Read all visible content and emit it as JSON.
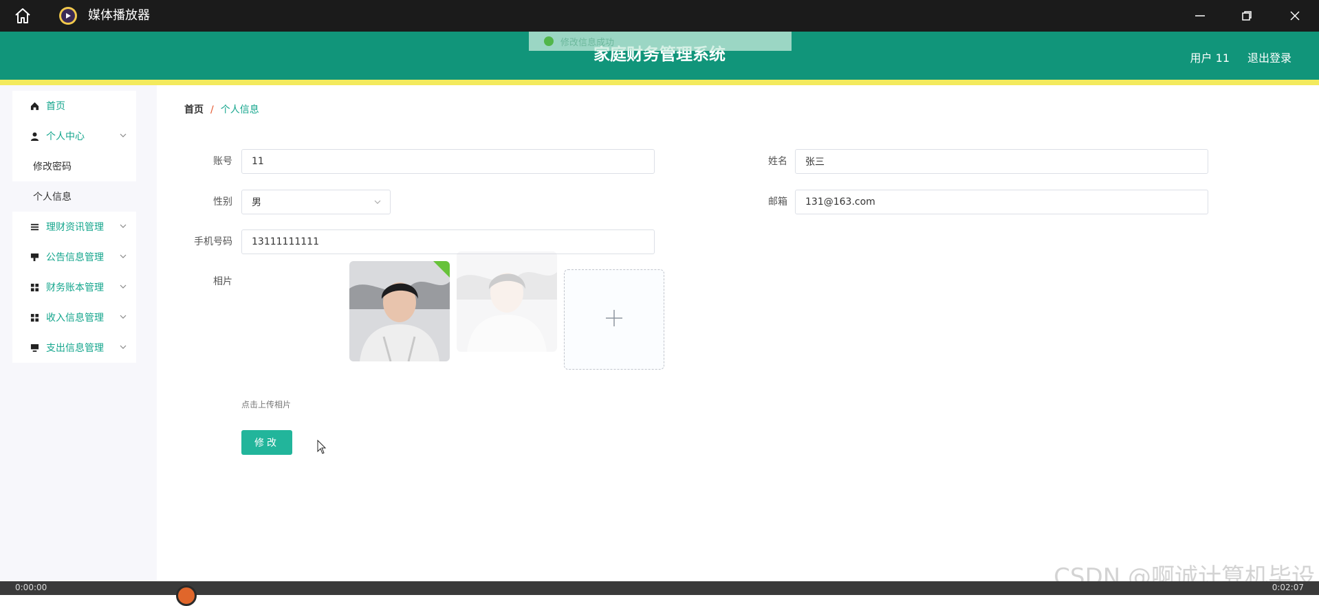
{
  "window": {
    "title": "媒体播放器",
    "controls": [
      "minimize-icon",
      "restore-icon",
      "close-icon"
    ]
  },
  "header": {
    "title": "家庭财务管理系统",
    "user": "用户 11",
    "logout": "退出登录",
    "bg_color": "#11957a",
    "accent_bar_color": "#f3ea5d"
  },
  "toast": {
    "message": "修改信息成功"
  },
  "sidebar": {
    "items": [
      {
        "label": "首页",
        "icon": "home-icon"
      },
      {
        "label": "个人中心",
        "icon": "user-icon",
        "expanded": true
      },
      {
        "label": "修改密码",
        "sub": true
      },
      {
        "label": "个人信息",
        "sub": true
      },
      {
        "label": "理财资讯管理",
        "icon": "list-icon"
      },
      {
        "label": "公告信息管理",
        "icon": "flag-icon"
      },
      {
        "label": "财务账本管理",
        "icon": "grid-icon"
      },
      {
        "label": "收入信息管理",
        "icon": "grid-icon"
      },
      {
        "label": "支出信息管理",
        "icon": "monitor-icon"
      }
    ]
  },
  "breadcrumb": {
    "home": "首页",
    "separator": "/",
    "current": "个人信息"
  },
  "form": {
    "account_label": "账号",
    "account_value": "11",
    "name_label": "姓名",
    "name_value": "张三",
    "gender_label": "性别",
    "gender_value": "男",
    "email_label": "邮箱",
    "email_value": "131@163.com",
    "phone_label": "手机号码",
    "phone_value": "13111111111",
    "photo_label": "相片",
    "upload_tip": "点击上传相片",
    "submit_label": "修改"
  },
  "watermark": "CSDN @啊诚计算机毕设",
  "player": {
    "time_left": "0:00:00",
    "time_right": "0:02:07"
  }
}
